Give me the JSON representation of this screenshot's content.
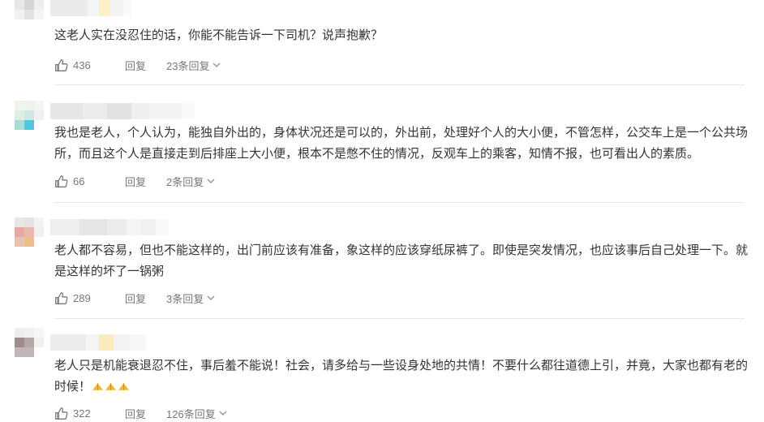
{
  "comments": [
    {
      "text": "这老人实在没忍住的话，你能不能告诉一下司机？说声抱歉？",
      "likes": "436",
      "reply_label": "回复",
      "replies_label": "23条回复"
    },
    {
      "text": "我也是老人，个人认为，能独自外出的，身体状况还是可以的，外出前，处理好个人的大小便，不管怎样，公交车上是一个公共场所，而且这个人是直接走到后排座上大小便，根本不是憋不住的情况，反观车上的乘客，知情不报，也可看出人的素质。",
      "likes": "66",
      "reply_label": "回复",
      "replies_label": "2条回复"
    },
    {
      "text": "老人都不容易，但也不能这样的，出门前应该有准备，象这样的应该穿纸尿裤了。即使是突发情况，也应该事后自己处理一下。就是这样的坏了一锅粥",
      "likes": "289",
      "reply_label": "回复",
      "replies_label": "3条回复"
    },
    {
      "text": "老人只是机能衰退忍不住，事后羞不能说！社会，请多给与一些设身处地的共情！不要什么都往道德上引，并竟，大家也都有老的时候！",
      "emoji_count": 3,
      "emoji_icon": "folded-hands-emoji",
      "likes": "322",
      "reply_label": "回复",
      "replies_label": "126条回复"
    }
  ],
  "icons": {
    "like": "thumbs-up-icon",
    "expand": "chevron-down-icon"
  },
  "colors": {
    "text": "#333333",
    "meta": "#777777",
    "divider": "#e8e8e8",
    "emoji": "#f2b632"
  }
}
